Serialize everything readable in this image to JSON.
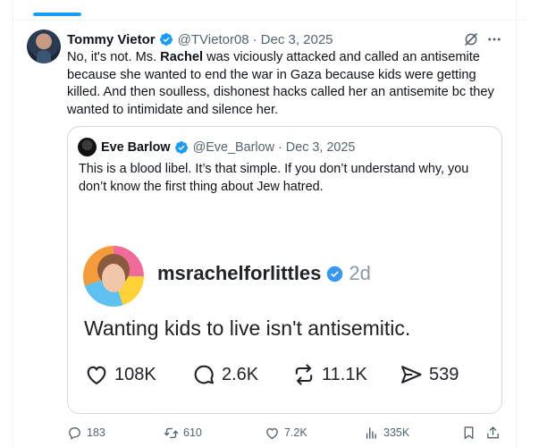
{
  "tweet": {
    "author_name": "Tommy Vietor",
    "handle": "@TVietor08",
    "date": "Dec 3, 2025",
    "text_before": "No, it's not. Ms. ",
    "text_bold": "Rachel",
    "text_after": " was viciously attacked and called an antisemite because she wanted to end the war in Gaza because kids were getting killed. And then soulless, dishonest hacks called her an antisemite bc they wanted to intimidate and silence her."
  },
  "quote": {
    "author_name": "Eve Barlow",
    "handle": "@Eve_Barlow",
    "date": "Dec 3, 2025",
    "text": "This is a blood libel. It’s that simple. If you don’t understand why, you don’t know the first thing about Jew hatred.",
    "image": {
      "username": "msrachelforlittles",
      "time": "2d",
      "caption": "Wanting kids to live isn't antisemitic.",
      "likes": "108K",
      "replies": "2.6K",
      "reposts": "11.1K",
      "shares": "539"
    }
  },
  "actions": {
    "replies": "183",
    "reposts": "610",
    "likes": "7.2K",
    "views": "335K"
  },
  "separator": "·",
  "colors": {
    "accent": "#1d9bf0",
    "text_secondary": "#536471",
    "border": "#cfd9de"
  },
  "icons": [
    "verified-badge-icon",
    "grok-icon",
    "more-icon",
    "reply-icon",
    "repost-icon",
    "like-icon",
    "views-icon",
    "bookmark-icon",
    "share-icon"
  ]
}
